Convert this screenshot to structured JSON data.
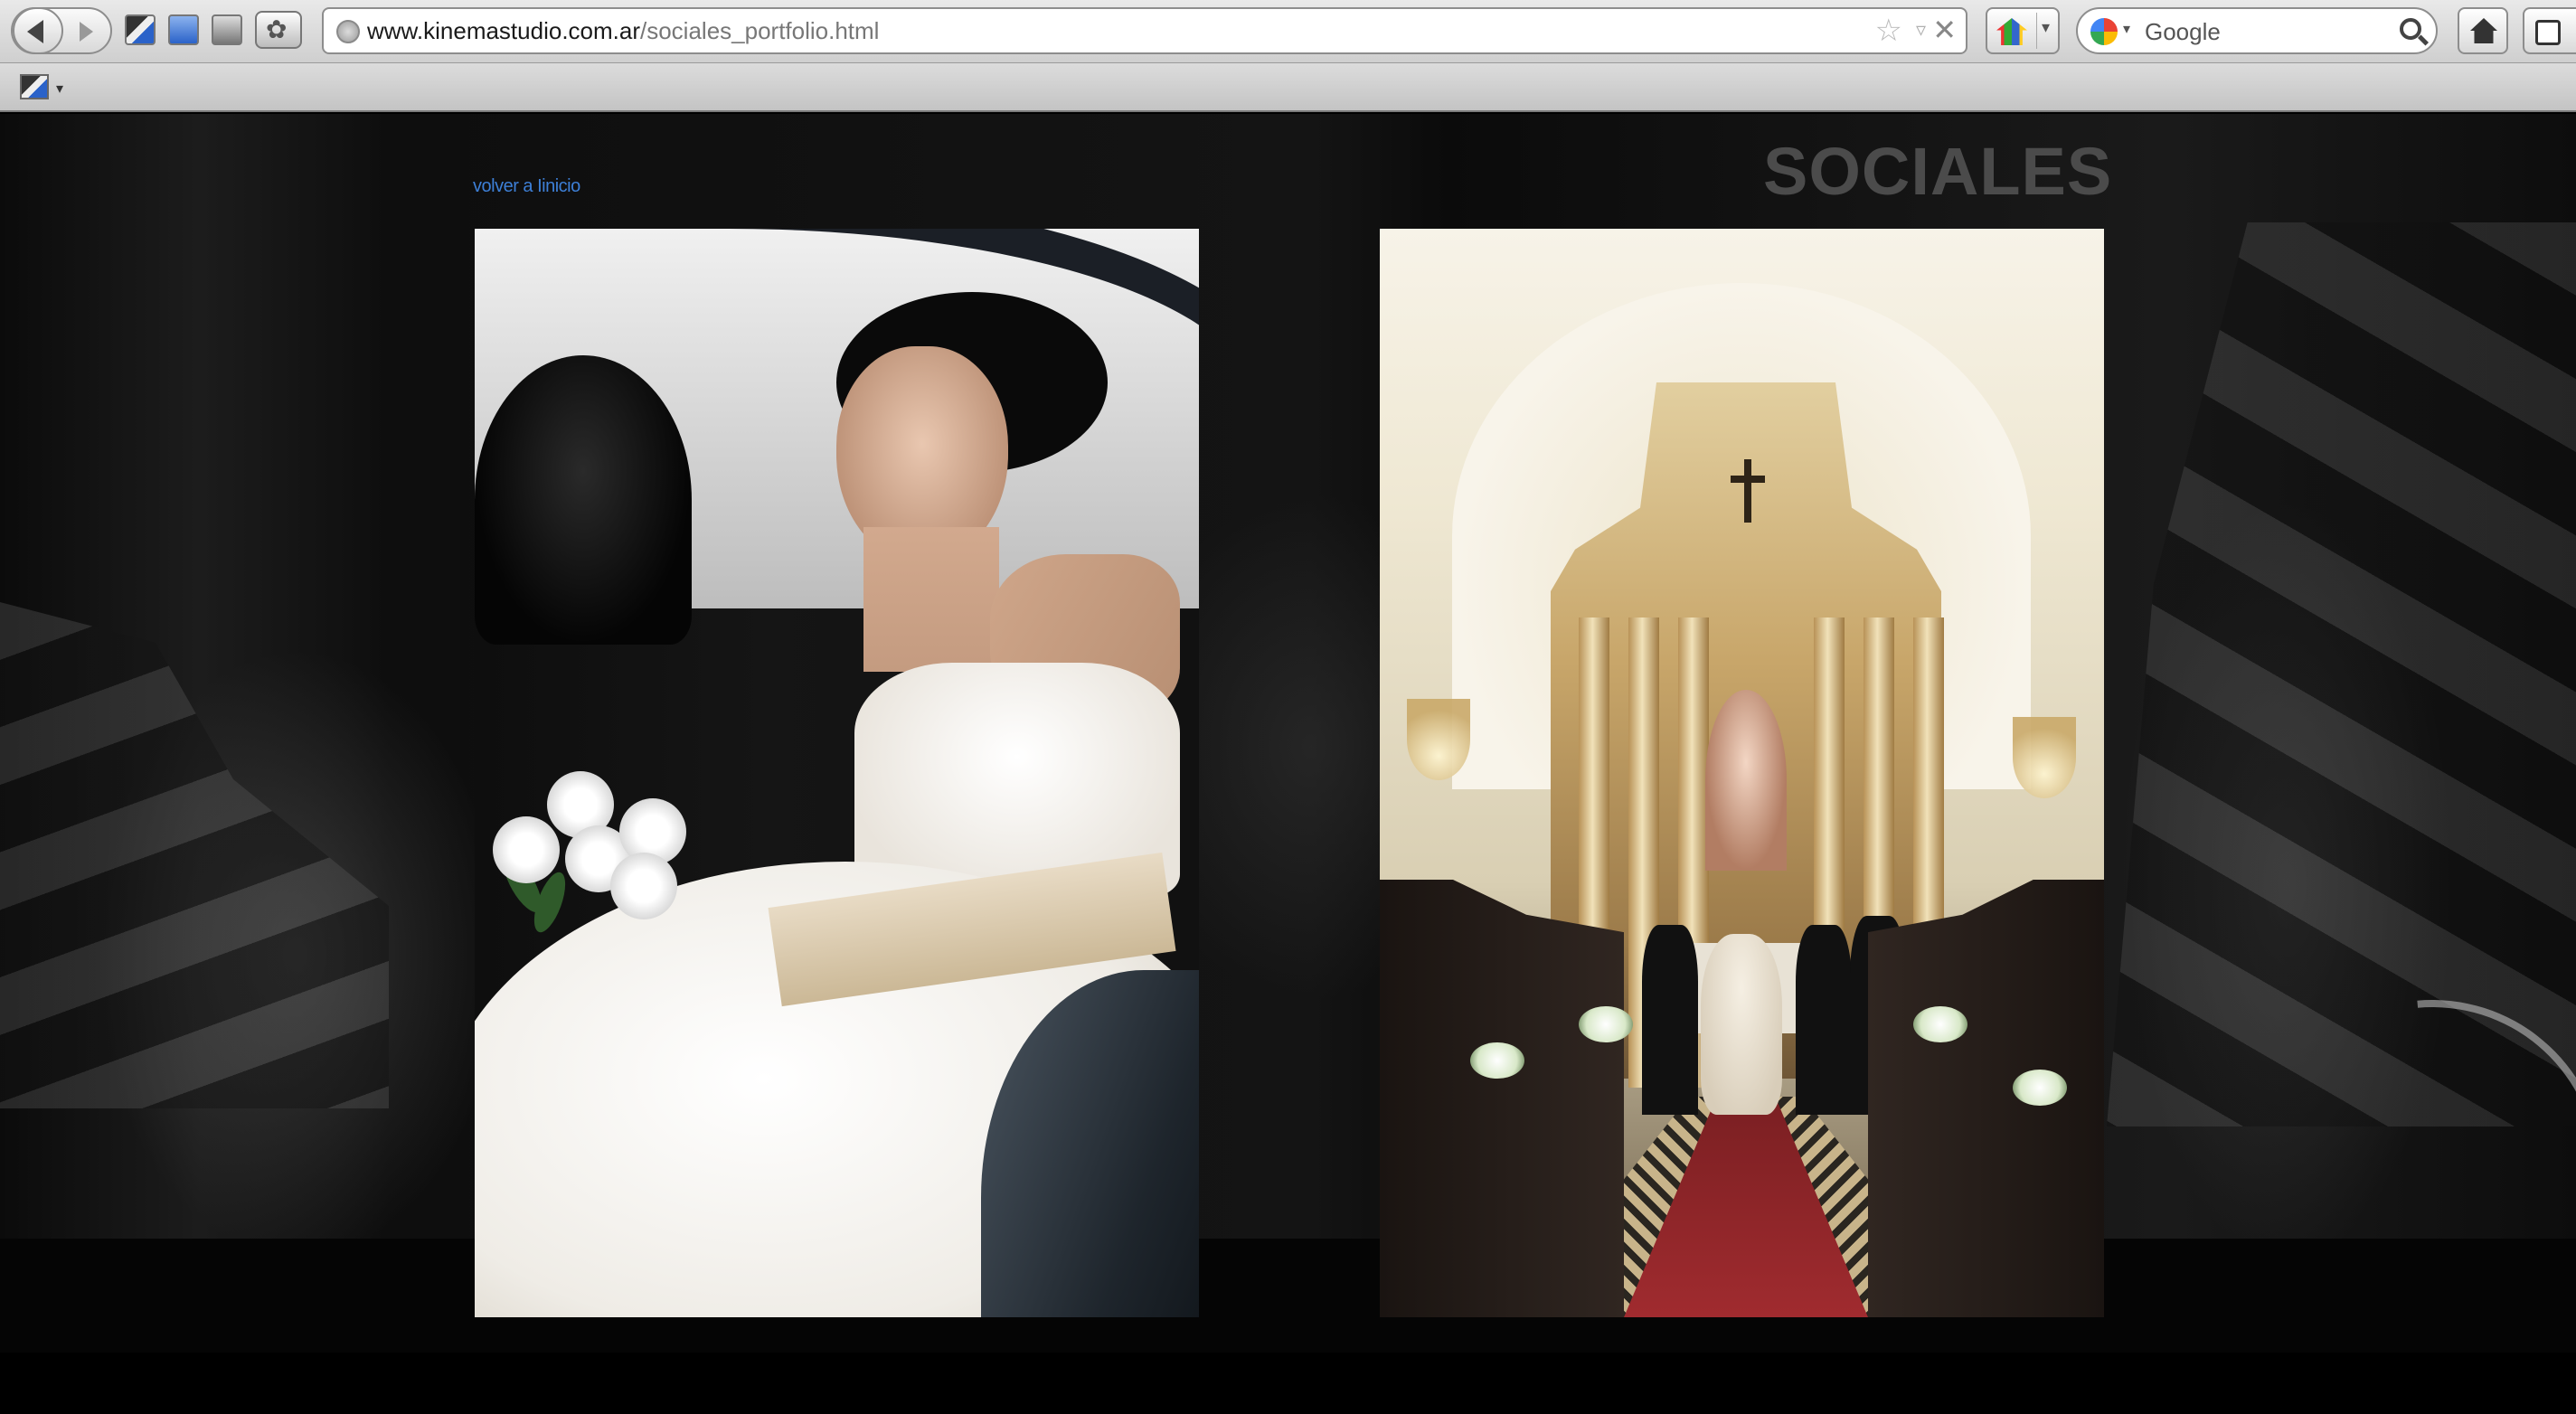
{
  "browser": {
    "url_domain": "www.kinemastudio.com.ar",
    "url_path": "/sociales_portfolio.html",
    "search_engine": "Google"
  },
  "page": {
    "title": "SOCIALES",
    "back_link": "volver a Iinicio",
    "link_color": "#3d7fd6",
    "title_color": "#4b4b4b",
    "photos": [
      {
        "subject": "bride stepping out of car with white rose bouquet"
      },
      {
        "subject": "church wedding ceremony with ornate golden altar and red carpet aisle"
      }
    ]
  }
}
